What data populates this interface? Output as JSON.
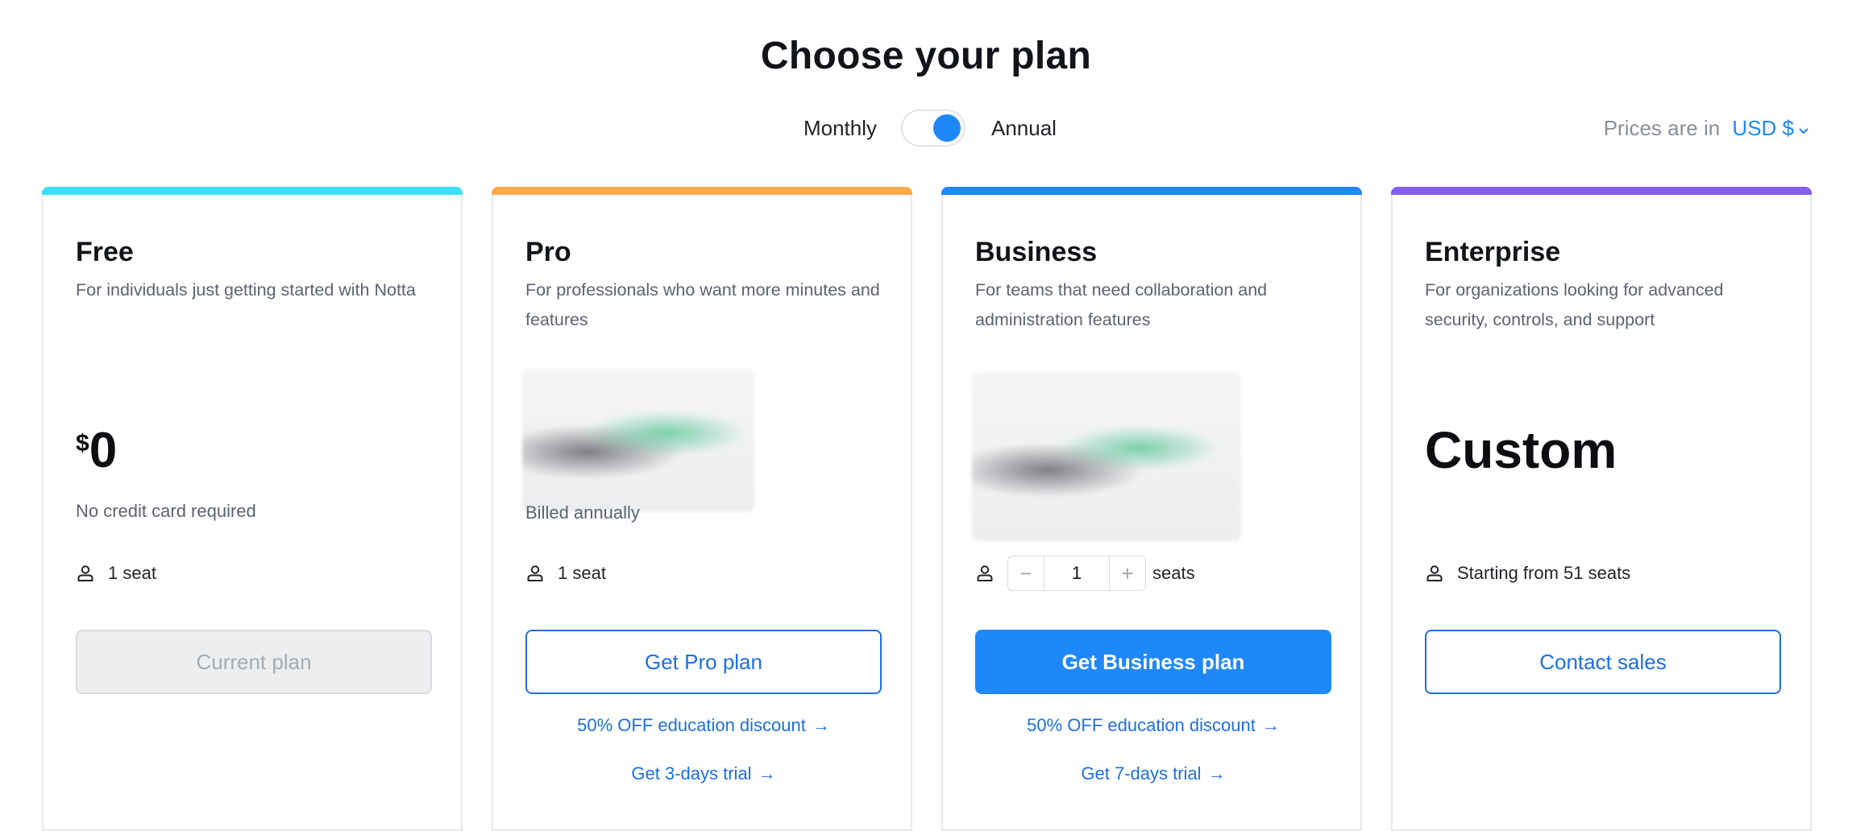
{
  "page_title": "Choose your plan",
  "billing": {
    "monthly_label": "Monthly",
    "annual_label": "Annual",
    "selected": "Annual"
  },
  "currency": {
    "prefix": "Prices are in",
    "value": "USD $"
  },
  "colors": {
    "accent": "#1e88f8",
    "bar_free": "#38e1f5",
    "bar_pro": "#ffa94d",
    "bar_business": "#1e88f8",
    "bar_enterprise": "#845ef7"
  },
  "plans": [
    {
      "name": "Free",
      "description": "For individuals just getting started with Notta",
      "price_currency": "$",
      "price_amount": "0",
      "note": "No credit card required",
      "seats_label": "1 seat",
      "cta": "Current plan"
    },
    {
      "name": "Pro",
      "description": "For professionals who want more minutes and features",
      "billed_note": "Billed annually",
      "seats_label": "1 seat",
      "cta": "Get Pro plan",
      "edu_link": "50% OFF education discount",
      "trial_link": "Get 3-days trial"
    },
    {
      "name": "Business",
      "description": "For teams that need collaboration and administration features",
      "seat_count": "1",
      "seats_suffix": "seats",
      "cta": "Get Business plan",
      "edu_link": "50% OFF education discount",
      "trial_link": "Get 7-days trial"
    },
    {
      "name": "Enterprise",
      "description": "For organizations looking for advanced security, controls, and support",
      "price_text": "Custom",
      "seats_label": "Starting from 51 seats",
      "cta": "Contact sales"
    }
  ]
}
